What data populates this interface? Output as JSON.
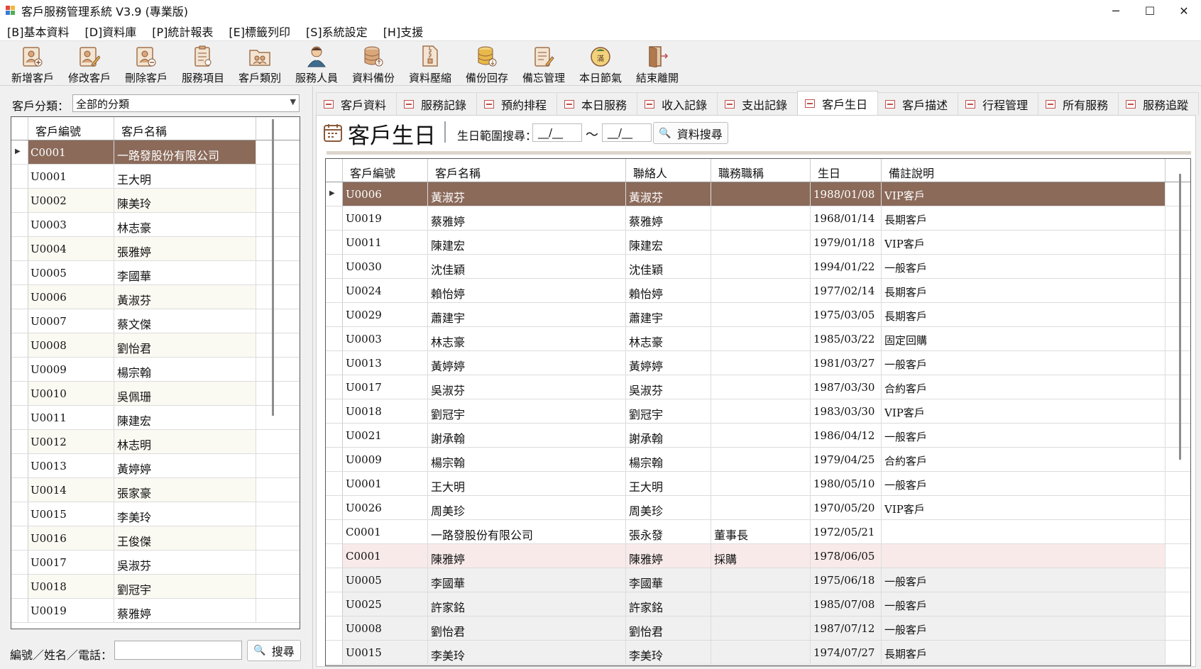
{
  "window": {
    "title": "客戶服務管理系統 V3.9 (專業版)",
    "controls": [
      "─",
      "☐",
      "✕"
    ]
  },
  "menu": [
    "[B]基本資料",
    "[D]資料庫",
    "[P]統計報表",
    "[E]標籤列印",
    "[S]系統設定",
    "[H]支援"
  ],
  "toolbar": [
    {
      "label": "新增客戶",
      "icon": "add-customer-icon"
    },
    {
      "label": "修改客戶",
      "icon": "edit-customer-icon"
    },
    {
      "label": "刪除客戶",
      "icon": "delete-customer-icon"
    },
    {
      "label": "服務項目",
      "icon": "service-items-icon"
    },
    {
      "label": "客戶類別",
      "icon": "customer-category-icon"
    },
    {
      "label": "服務人員",
      "icon": "service-staff-icon"
    },
    {
      "label": "資料備份",
      "icon": "backup-icon"
    },
    {
      "label": "資料壓縮",
      "icon": "compress-icon"
    },
    {
      "label": "備份回存",
      "icon": "restore-icon"
    },
    {
      "label": "備忘管理",
      "icon": "memo-icon"
    },
    {
      "label": "本日節氣",
      "icon": "solar-term-icon"
    },
    {
      "label": "結束離開",
      "icon": "exit-icon"
    }
  ],
  "left": {
    "category_label": "客戶分類：",
    "category_value": "全部的分類",
    "columns": [
      "客戶編號",
      "客戶名稱"
    ],
    "rows": [
      [
        "C0001",
        "一路發股份有限公司"
      ],
      [
        "U0001",
        "王大明"
      ],
      [
        "U0002",
        "陳美玲"
      ],
      [
        "U0003",
        "林志豪"
      ],
      [
        "U0004",
        "張雅婷"
      ],
      [
        "U0005",
        "李國華"
      ],
      [
        "U0006",
        "黃淑芬"
      ],
      [
        "U0007",
        "蔡文傑"
      ],
      [
        "U0008",
        "劉怡君"
      ],
      [
        "U0009",
        "楊宗翰"
      ],
      [
        "U0010",
        "吳佩珊"
      ],
      [
        "U0011",
        "陳建宏"
      ],
      [
        "U0012",
        "林志明"
      ],
      [
        "U0013",
        "黃婷婷"
      ],
      [
        "U0014",
        "張家豪"
      ],
      [
        "U0015",
        "李美玲"
      ],
      [
        "U0016",
        "王俊傑"
      ],
      [
        "U0017",
        "吳淑芬"
      ],
      [
        "U0018",
        "劉冠宇"
      ],
      [
        "U0019",
        "蔡雅婷"
      ]
    ],
    "search_label": "編號／姓名／電話：",
    "search_value": "",
    "search_button": "搜尋"
  },
  "tabs": [
    "客戶資料",
    "服務記錄",
    "預約排程",
    "本日服務",
    "收入記錄",
    "支出記錄",
    "客戶生日",
    "客戶描述",
    "行程管理",
    "所有服務",
    "服務追蹤"
  ],
  "active_tab": "客戶生日",
  "birthday": {
    "title": "客戶生日",
    "range_label": "生日範圍搜尋：",
    "date_from": "__/__",
    "tilde": "～",
    "date_to": "__/__",
    "search_button": "資料搜尋",
    "columns": [
      "客戶編號",
      "客戶名稱",
      "聯絡人",
      "職務職稱",
      "生日",
      "備註說明"
    ],
    "rows": [
      [
        "U0006",
        "黃淑芬",
        "黃淑芬",
        "",
        "1988/01/08",
        "VIP客戶"
      ],
      [
        "U0019",
        "蔡雅婷",
        "蔡雅婷",
        "",
        "1968/01/14",
        "長期客戶"
      ],
      [
        "U0011",
        "陳建宏",
        "陳建宏",
        "",
        "1979/01/18",
        "VIP客戶"
      ],
      [
        "U0030",
        "沈佳穎",
        "沈佳穎",
        "",
        "1994/01/22",
        "一般客戶"
      ],
      [
        "U0024",
        "賴怡婷",
        "賴怡婷",
        "",
        "1977/02/14",
        "長期客戶"
      ],
      [
        "U0029",
        "蕭建宇",
        "蕭建宇",
        "",
        "1975/03/05",
        "長期客戶"
      ],
      [
        "U0003",
        "林志豪",
        "林志豪",
        "",
        "1985/03/22",
        "固定回購"
      ],
      [
        "U0013",
        "黃婷婷",
        "黃婷婷",
        "",
        "1981/03/27",
        "一般客戶"
      ],
      [
        "U0017",
        "吳淑芬",
        "吳淑芬",
        "",
        "1987/03/30",
        "合約客戶"
      ],
      [
        "U0018",
        "劉冠宇",
        "劉冠宇",
        "",
        "1983/03/30",
        "VIP客戶"
      ],
      [
        "U0021",
        "謝承翰",
        "謝承翰",
        "",
        "1986/04/12",
        "一般客戶"
      ],
      [
        "U0009",
        "楊宗翰",
        "楊宗翰",
        "",
        "1979/04/25",
        "合約客戶"
      ],
      [
        "U0001",
        "王大明",
        "王大明",
        "",
        "1980/05/10",
        "一般客戶"
      ],
      [
        "U0026",
        "周美珍",
        "周美珍",
        "",
        "1970/05/20",
        "VIP客戶"
      ],
      [
        "C0001",
        "一路發股份有限公司",
        "張永發",
        "董事長",
        "1972/05/21",
        ""
      ],
      [
        "C0001",
        "陳雅婷",
        "陳雅婷",
        "採購",
        "1978/06/05",
        ""
      ],
      [
        "U0005",
        "李國華",
        "李國華",
        "",
        "1975/06/18",
        "一般客戶"
      ],
      [
        "U0025",
        "許家銘",
        "許家銘",
        "",
        "1985/07/08",
        "一般客戶"
      ],
      [
        "U0008",
        "劉怡君",
        "劉怡君",
        "",
        "1987/07/12",
        "一般客戶"
      ],
      [
        "U0015",
        "李美玲",
        "李美玲",
        "",
        "1974/07/27",
        "長期客戶"
      ]
    ]
  },
  "colors": {
    "selection": "#8b6a5a",
    "highlight_row": "#f9eaea",
    "alt_row": "#fbfaf2",
    "tab_icon": "#c0504d"
  }
}
